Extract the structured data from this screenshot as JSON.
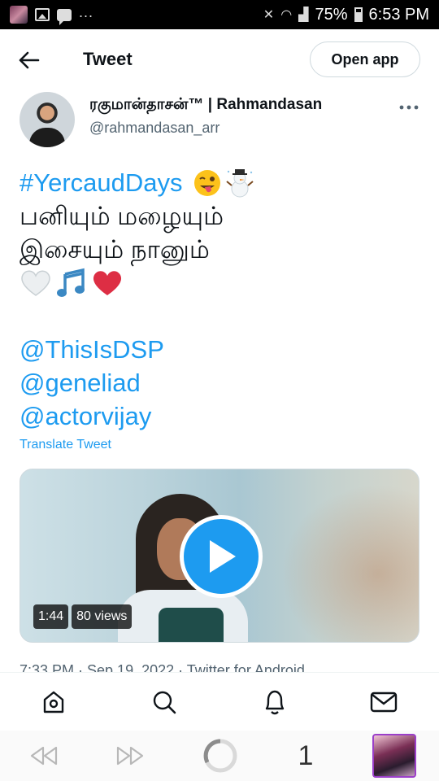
{
  "status_bar": {
    "overflow": "...",
    "battery": "75%",
    "time": "6:53 PM"
  },
  "header": {
    "title": "Tweet",
    "open_app_label": "Open app"
  },
  "author": {
    "name": "ரகுமான்தாசன்™ | Rahmandasan",
    "handle": "@rahmandasan_arr"
  },
  "tweet": {
    "hashtag": "#YercaudDays",
    "line1": "பனியும் மழையும்",
    "line2": "இசையும் நானும்",
    "mentions": [
      "@ThisIsDSP",
      "@geneliad",
      "@actorvijay"
    ],
    "translate_label": "Translate Tweet"
  },
  "video": {
    "duration": "1:44",
    "views": "80 views"
  },
  "meta": "7:33 PM · Sep 19, 2022 · Twitter for Android",
  "browser": {
    "tab_count": "1"
  },
  "colors": {
    "accent": "#1d9bf0",
    "text": "#0f1419",
    "secondary": "#536471"
  }
}
